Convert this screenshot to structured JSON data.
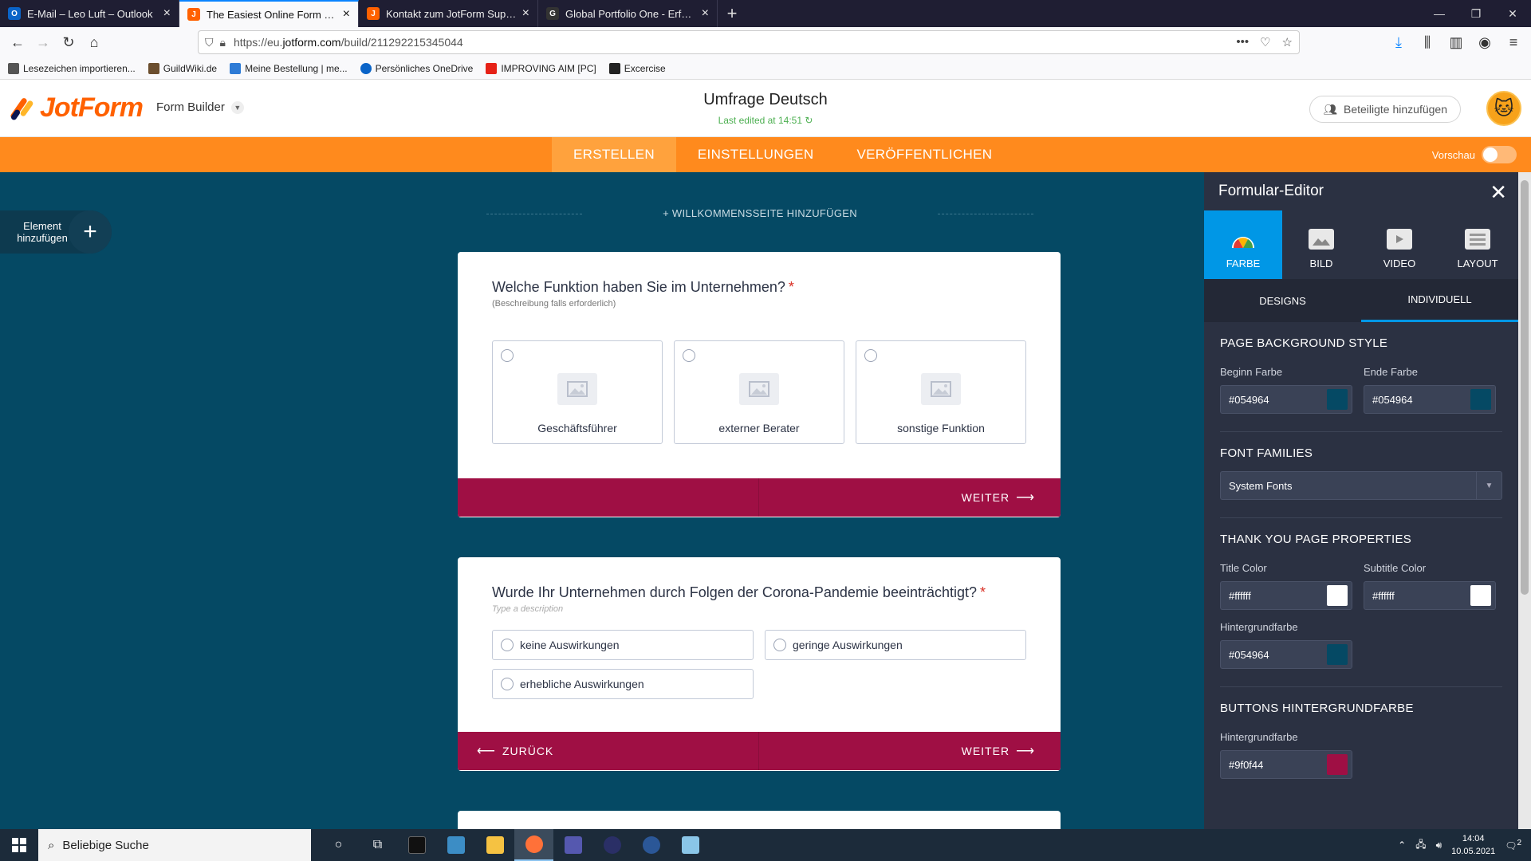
{
  "browser": {
    "tabs": [
      {
        "label": "E-Mail – Leo Luft – Outlook",
        "icon": "outlook-icon",
        "color": "#0a64c8",
        "active": false
      },
      {
        "label": "The Easiest Online Form Builder",
        "icon": "jotform-icon",
        "color": "#ff6100",
        "active": true
      },
      {
        "label": "Kontakt zum JotForm Support",
        "icon": "jotform-icon",
        "color": "#ff6100",
        "active": false
      },
      {
        "label": "Global Portfolio One - Erfolgre",
        "icon": "gpo-icon",
        "color": "#333333",
        "active": false
      }
    ],
    "url_prefix": "https://eu.",
    "url_domain": "jotform.com",
    "url_path": "/build/211292215345044",
    "bookmarks": [
      {
        "label": "Lesezeichen importieren...",
        "color": "#555555"
      },
      {
        "label": "GuildWiki.de",
        "color": "#6b4e2e"
      },
      {
        "label": "Meine Bestellung | me...",
        "color": "#2e7bd6"
      },
      {
        "label": "Persönliches OneDrive",
        "color": "#0a64c8"
      },
      {
        "label": "IMPROVING AIM [PC]",
        "color": "#e62117"
      },
      {
        "label": "Excercise",
        "color": "#222222"
      }
    ]
  },
  "header": {
    "logo_text": "JotForm",
    "builder_label": "Form Builder",
    "form_title": "Umfrage Deutsch",
    "last_edited": "Last edited at 14:51",
    "collab_label": "Beteiligte hinzufügen"
  },
  "menu": {
    "items": [
      "ERSTELLEN",
      "EINSTELLUNGEN",
      "VERÖFFENTLICHEN"
    ],
    "active_index": 0,
    "preview_label": "Vorschau"
  },
  "canvas": {
    "add_element_label": "Element hinzufügen",
    "welcome_label": "+ WILLKOMMENSSEITE HINZUFÜGEN",
    "q1": {
      "question": "Welche Funktion haben Sie im Unternehmen?",
      "required_mark": "*",
      "description": "(Beschreibung falls erforderlich)",
      "options": [
        "Geschäftsführer",
        "externer Berater",
        "sonstige Funktion"
      ],
      "next_label": "WEITER"
    },
    "q2": {
      "question": "Wurde Ihr Unternehmen durch Folgen der Corona-Pandemie beeinträchtigt?",
      "required_mark": "*",
      "description": "Type a description",
      "options": [
        "keine Auswirkungen",
        "geringe Auswirkungen",
        "erhebliche Auswirkungen"
      ],
      "back_label": "ZURÜCK",
      "next_label": "WEITER"
    }
  },
  "panel": {
    "title": "Formular-Editor",
    "tabs": [
      "FARBE",
      "BILD",
      "VIDEO",
      "LAYOUT"
    ],
    "subtabs": [
      "DESIGNS",
      "INDIVIDUELL"
    ],
    "page_bg": {
      "heading": "PAGE BACKGROUND STYLE",
      "begin_label": "Beginn Farbe",
      "begin_value": "#054964",
      "end_label": "Ende Farbe",
      "end_value": "#054964"
    },
    "fonts": {
      "heading": "FONT FAMILIES",
      "value": "System Fonts"
    },
    "thankyou": {
      "heading": "THANK YOU PAGE PROPERTIES",
      "title_label": "Title Color",
      "title_value": "#ffffff",
      "subtitle_label": "Subtitle Color",
      "subtitle_value": "#ffffff",
      "bg_label": "Hintergrundfarbe",
      "bg_value": "#054964"
    },
    "buttons": {
      "heading": "BUTTONS HINTERGRUNDFARBE",
      "bg_label": "Hintergrundfarbe",
      "bg_value": "#9f0f44"
    }
  },
  "taskbar": {
    "search_placeholder": "Beliebige Suche",
    "time": "14:04",
    "date": "10.05.2021",
    "notification_count": "2"
  }
}
